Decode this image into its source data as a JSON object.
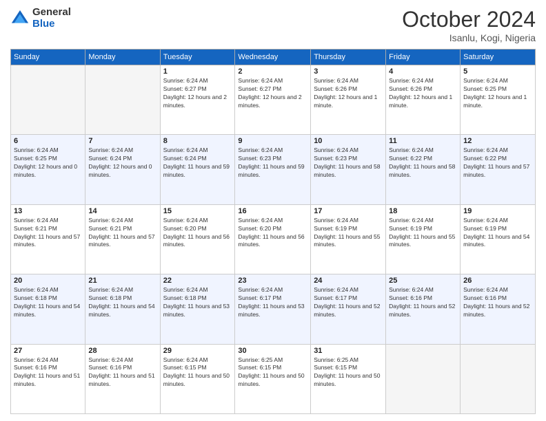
{
  "logo": {
    "general": "General",
    "blue": "Blue"
  },
  "title": "October 2024",
  "location": "Isanlu, Kogi, Nigeria",
  "weekdays": [
    "Sunday",
    "Monday",
    "Tuesday",
    "Wednesday",
    "Thursday",
    "Friday",
    "Saturday"
  ],
  "weeks": [
    [
      {
        "day": "",
        "sunrise": "",
        "sunset": "",
        "daylight": ""
      },
      {
        "day": "",
        "sunrise": "",
        "sunset": "",
        "daylight": ""
      },
      {
        "day": "1",
        "sunrise": "Sunrise: 6:24 AM",
        "sunset": "Sunset: 6:27 PM",
        "daylight": "Daylight: 12 hours and 2 minutes."
      },
      {
        "day": "2",
        "sunrise": "Sunrise: 6:24 AM",
        "sunset": "Sunset: 6:27 PM",
        "daylight": "Daylight: 12 hours and 2 minutes."
      },
      {
        "day": "3",
        "sunrise": "Sunrise: 6:24 AM",
        "sunset": "Sunset: 6:26 PM",
        "daylight": "Daylight: 12 hours and 1 minute."
      },
      {
        "day": "4",
        "sunrise": "Sunrise: 6:24 AM",
        "sunset": "Sunset: 6:26 PM",
        "daylight": "Daylight: 12 hours and 1 minute."
      },
      {
        "day": "5",
        "sunrise": "Sunrise: 6:24 AM",
        "sunset": "Sunset: 6:25 PM",
        "daylight": "Daylight: 12 hours and 1 minute."
      }
    ],
    [
      {
        "day": "6",
        "sunrise": "Sunrise: 6:24 AM",
        "sunset": "Sunset: 6:25 PM",
        "daylight": "Daylight: 12 hours and 0 minutes."
      },
      {
        "day": "7",
        "sunrise": "Sunrise: 6:24 AM",
        "sunset": "Sunset: 6:24 PM",
        "daylight": "Daylight: 12 hours and 0 minutes."
      },
      {
        "day": "8",
        "sunrise": "Sunrise: 6:24 AM",
        "sunset": "Sunset: 6:24 PM",
        "daylight": "Daylight: 11 hours and 59 minutes."
      },
      {
        "day": "9",
        "sunrise": "Sunrise: 6:24 AM",
        "sunset": "Sunset: 6:23 PM",
        "daylight": "Daylight: 11 hours and 59 minutes."
      },
      {
        "day": "10",
        "sunrise": "Sunrise: 6:24 AM",
        "sunset": "Sunset: 6:23 PM",
        "daylight": "Daylight: 11 hours and 58 minutes."
      },
      {
        "day": "11",
        "sunrise": "Sunrise: 6:24 AM",
        "sunset": "Sunset: 6:22 PM",
        "daylight": "Daylight: 11 hours and 58 minutes."
      },
      {
        "day": "12",
        "sunrise": "Sunrise: 6:24 AM",
        "sunset": "Sunset: 6:22 PM",
        "daylight": "Daylight: 11 hours and 57 minutes."
      }
    ],
    [
      {
        "day": "13",
        "sunrise": "Sunrise: 6:24 AM",
        "sunset": "Sunset: 6:21 PM",
        "daylight": "Daylight: 11 hours and 57 minutes."
      },
      {
        "day": "14",
        "sunrise": "Sunrise: 6:24 AM",
        "sunset": "Sunset: 6:21 PM",
        "daylight": "Daylight: 11 hours and 57 minutes."
      },
      {
        "day": "15",
        "sunrise": "Sunrise: 6:24 AM",
        "sunset": "Sunset: 6:20 PM",
        "daylight": "Daylight: 11 hours and 56 minutes."
      },
      {
        "day": "16",
        "sunrise": "Sunrise: 6:24 AM",
        "sunset": "Sunset: 6:20 PM",
        "daylight": "Daylight: 11 hours and 56 minutes."
      },
      {
        "day": "17",
        "sunrise": "Sunrise: 6:24 AM",
        "sunset": "Sunset: 6:19 PM",
        "daylight": "Daylight: 11 hours and 55 minutes."
      },
      {
        "day": "18",
        "sunrise": "Sunrise: 6:24 AM",
        "sunset": "Sunset: 6:19 PM",
        "daylight": "Daylight: 11 hours and 55 minutes."
      },
      {
        "day": "19",
        "sunrise": "Sunrise: 6:24 AM",
        "sunset": "Sunset: 6:19 PM",
        "daylight": "Daylight: 11 hours and 54 minutes."
      }
    ],
    [
      {
        "day": "20",
        "sunrise": "Sunrise: 6:24 AM",
        "sunset": "Sunset: 6:18 PM",
        "daylight": "Daylight: 11 hours and 54 minutes."
      },
      {
        "day": "21",
        "sunrise": "Sunrise: 6:24 AM",
        "sunset": "Sunset: 6:18 PM",
        "daylight": "Daylight: 11 hours and 54 minutes."
      },
      {
        "day": "22",
        "sunrise": "Sunrise: 6:24 AM",
        "sunset": "Sunset: 6:18 PM",
        "daylight": "Daylight: 11 hours and 53 minutes."
      },
      {
        "day": "23",
        "sunrise": "Sunrise: 6:24 AM",
        "sunset": "Sunset: 6:17 PM",
        "daylight": "Daylight: 11 hours and 53 minutes."
      },
      {
        "day": "24",
        "sunrise": "Sunrise: 6:24 AM",
        "sunset": "Sunset: 6:17 PM",
        "daylight": "Daylight: 11 hours and 52 minutes."
      },
      {
        "day": "25",
        "sunrise": "Sunrise: 6:24 AM",
        "sunset": "Sunset: 6:16 PM",
        "daylight": "Daylight: 11 hours and 52 minutes."
      },
      {
        "day": "26",
        "sunrise": "Sunrise: 6:24 AM",
        "sunset": "Sunset: 6:16 PM",
        "daylight": "Daylight: 11 hours and 52 minutes."
      }
    ],
    [
      {
        "day": "27",
        "sunrise": "Sunrise: 6:24 AM",
        "sunset": "Sunset: 6:16 PM",
        "daylight": "Daylight: 11 hours and 51 minutes."
      },
      {
        "day": "28",
        "sunrise": "Sunrise: 6:24 AM",
        "sunset": "Sunset: 6:16 PM",
        "daylight": "Daylight: 11 hours and 51 minutes."
      },
      {
        "day": "29",
        "sunrise": "Sunrise: 6:24 AM",
        "sunset": "Sunset: 6:15 PM",
        "daylight": "Daylight: 11 hours and 50 minutes."
      },
      {
        "day": "30",
        "sunrise": "Sunrise: 6:25 AM",
        "sunset": "Sunset: 6:15 PM",
        "daylight": "Daylight: 11 hours and 50 minutes."
      },
      {
        "day": "31",
        "sunrise": "Sunrise: 6:25 AM",
        "sunset": "Sunset: 6:15 PM",
        "daylight": "Daylight: 11 hours and 50 minutes."
      },
      {
        "day": "",
        "sunrise": "",
        "sunset": "",
        "daylight": ""
      },
      {
        "day": "",
        "sunrise": "",
        "sunset": "",
        "daylight": ""
      }
    ]
  ]
}
